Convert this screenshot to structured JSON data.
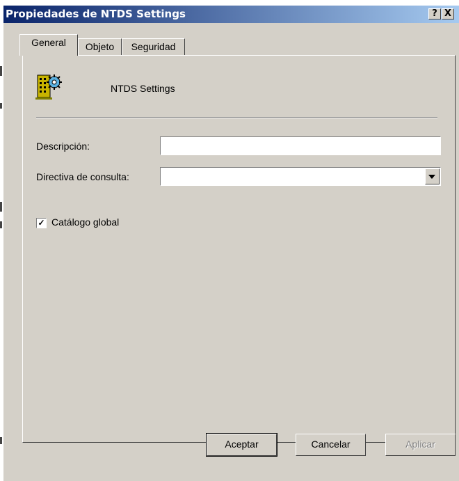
{
  "window": {
    "title": "Propiedades de NTDS Settings",
    "help_label": "?",
    "close_label": "X"
  },
  "tabs": [
    {
      "label": "General",
      "active": true
    },
    {
      "label": "Objeto",
      "active": false
    },
    {
      "label": "Seguridad",
      "active": false
    }
  ],
  "general": {
    "object_icon": "server-gear-icon",
    "object_name": "NTDS Settings",
    "description_label": "Descripción:",
    "description_value": "",
    "query_policy_label": "Directiva de consulta:",
    "query_policy_value": "",
    "global_catalog_label": "Catálogo global",
    "global_catalog_checked": true
  },
  "buttons": {
    "ok": "Aceptar",
    "cancel": "Cancelar",
    "apply": "Aplicar"
  },
  "colors": {
    "titlebar_start": "#0a246a",
    "titlebar_end": "#a6caf0",
    "face": "#d4d0c8"
  }
}
